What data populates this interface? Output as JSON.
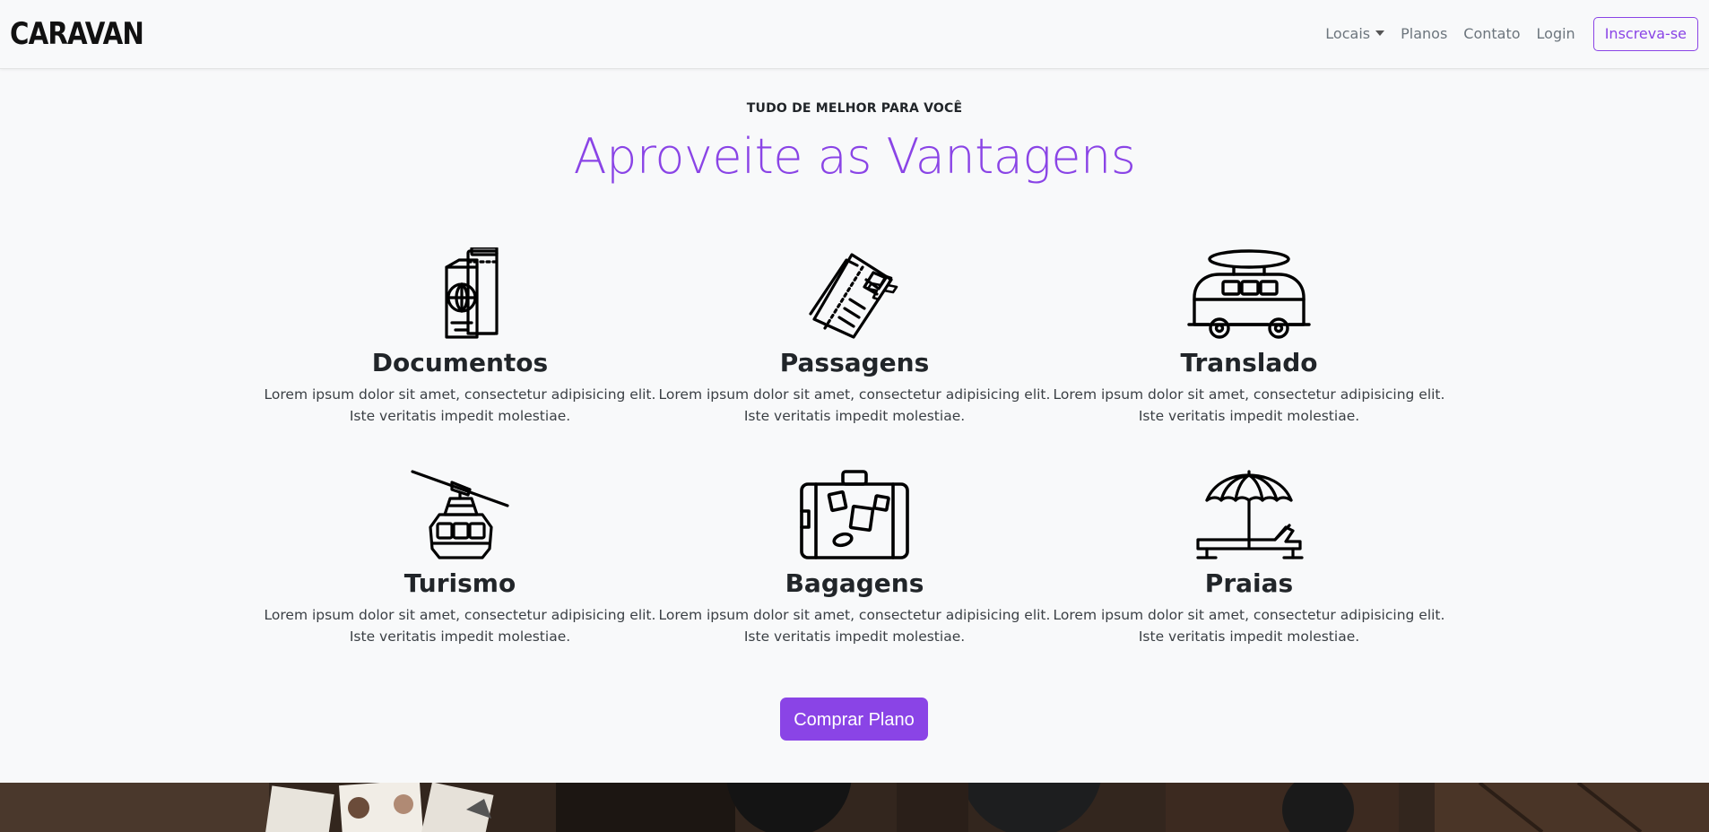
{
  "navbar": {
    "brand": "CARAVAN",
    "links": [
      {
        "label": "Locais"
      },
      {
        "label": "Planos"
      },
      {
        "label": "Contato"
      },
      {
        "label": "Login"
      }
    ],
    "signup_label": "Inscreva-se"
  },
  "section": {
    "kicker": "TUDO DE MELHOR PARA VOCÊ",
    "headline": "Aproveite as Vantagens"
  },
  "features": [
    {
      "icon": "passport-icon",
      "title": "Documentos",
      "desc_line1": "Lorem ipsum dolor sit amet, consectetur adipisicing elit.",
      "desc_line2": "Iste veritatis impedit molestiae."
    },
    {
      "icon": "plane-tickets-icon",
      "title": "Passagens",
      "desc_line1": "Lorem ipsum dolor sit amet, consectetur adipisicing elit.",
      "desc_line2": "Iste veritatis impedit molestiae."
    },
    {
      "icon": "van-icon",
      "title": "Translado",
      "desc_line1": "Lorem ipsum dolor sit amet, consectetur adipisicing elit.",
      "desc_line2": "Iste veritatis impedit molestiae."
    },
    {
      "icon": "cable-car-icon",
      "title": "Turismo",
      "desc_line1": "Lorem ipsum dolor sit amet, consectetur adipisicing elit.",
      "desc_line2": "Iste veritatis impedit molestiae."
    },
    {
      "icon": "suitcase-icon",
      "title": "Bagagens",
      "desc_line1": "Lorem ipsum dolor sit amet, consectetur adipisicing elit.",
      "desc_line2": "Iste veritatis impedit molestiae."
    },
    {
      "icon": "beach-umbrella-icon",
      "title": "Praias",
      "desc_line1": "Lorem ipsum dolor sit amet, consectetur adipisicing elit.",
      "desc_line2": "Iste veritatis impedit molestiae."
    }
  ],
  "cta": {
    "label": "Comprar Plano"
  },
  "colors": {
    "accent": "#8a44e6",
    "background": "#f8f9fa",
    "text": "#212529"
  }
}
